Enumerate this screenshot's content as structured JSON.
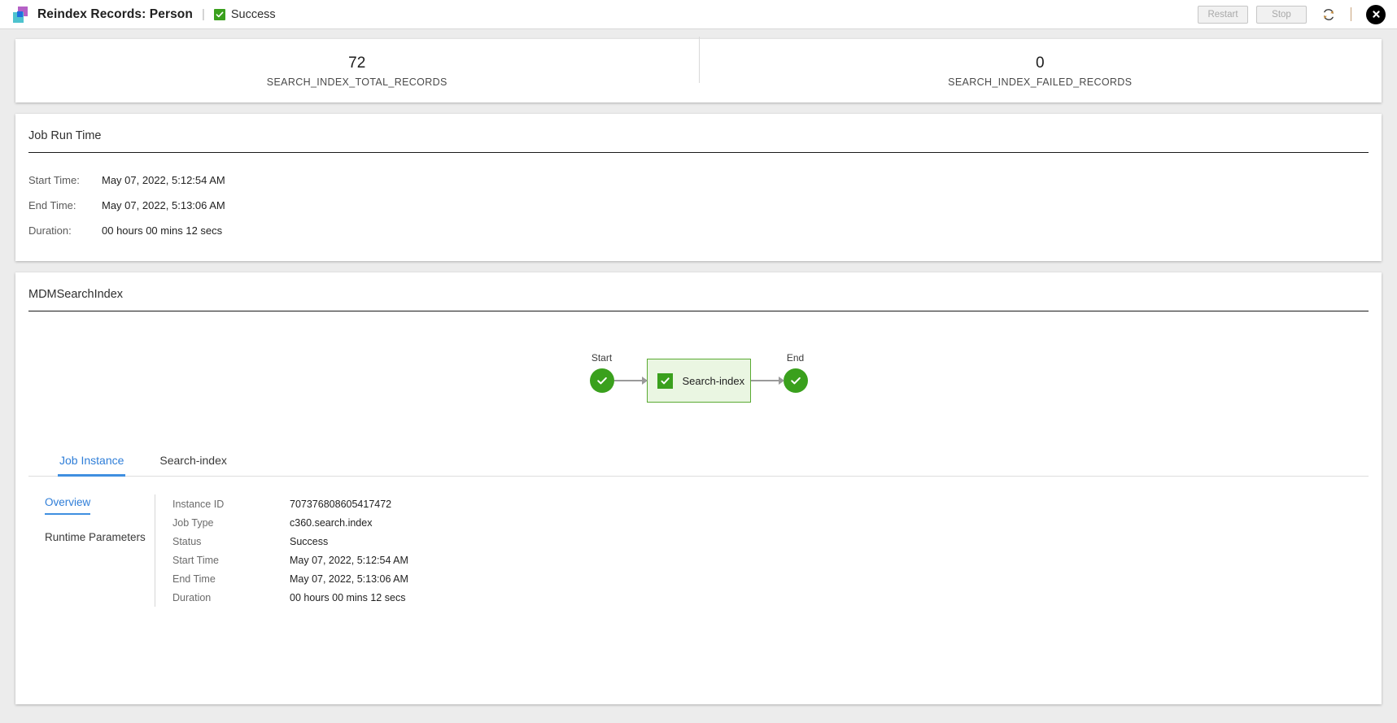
{
  "titlebar": {
    "logo_icon": "informatica-logo-icon",
    "title": "Reindex Records: Person",
    "separator": "|",
    "status_icon": "check-square-icon",
    "status": "Success",
    "restart_label": "Restart",
    "stop_label": "Stop",
    "refresh_icon": "refresh-icon",
    "close_icon": "close-circle-icon"
  },
  "kpis": [
    {
      "value": "72",
      "label": "SEARCH_INDEX_TOTAL_RECORDS"
    },
    {
      "value": "0",
      "label": "SEARCH_INDEX_FAILED_RECORDS"
    }
  ],
  "job_run_time": {
    "heading": "Job Run Time",
    "rows": [
      {
        "key": "Start Time:",
        "value": "May 07, 2022, 5:12:54 AM"
      },
      {
        "key": "End Time:",
        "value": "May 07, 2022, 5:13:06 AM"
      },
      {
        "key": "Duration:",
        "value": "00 hours 00 mins 12 secs"
      }
    ]
  },
  "flow": {
    "heading": "MDMSearchIndex",
    "start_label": "Start",
    "end_label": "End",
    "task_label": "Search-index",
    "start_icon": "check-circle-icon",
    "end_icon": "check-circle-icon",
    "task_icon": "check-square-icon",
    "colors": {
      "success_green": "#3aa01d",
      "task_fill": "#eaf6e2",
      "task_border": "#5aaa32",
      "connector": "#9a9a9a"
    }
  },
  "tabs": [
    {
      "label": "Job Instance",
      "active": true
    },
    {
      "label": "Search-index",
      "active": false
    }
  ],
  "subnav": [
    {
      "label": "Overview",
      "active": true
    },
    {
      "label": "Runtime Parameters",
      "active": false
    }
  ],
  "overview": {
    "rows": [
      {
        "key": "Instance ID",
        "value": "707376808605417472"
      },
      {
        "key": "Job Type",
        "value": "c360.search.index"
      },
      {
        "key": "Status",
        "value": "Success"
      },
      {
        "key": "Start Time",
        "value": "May 07, 2022, 5:12:54 AM"
      },
      {
        "key": "End Time",
        "value": "May 07, 2022, 5:13:06 AM"
      },
      {
        "key": "Duration",
        "value": "00 hours 00 mins 12 secs"
      }
    ]
  }
}
